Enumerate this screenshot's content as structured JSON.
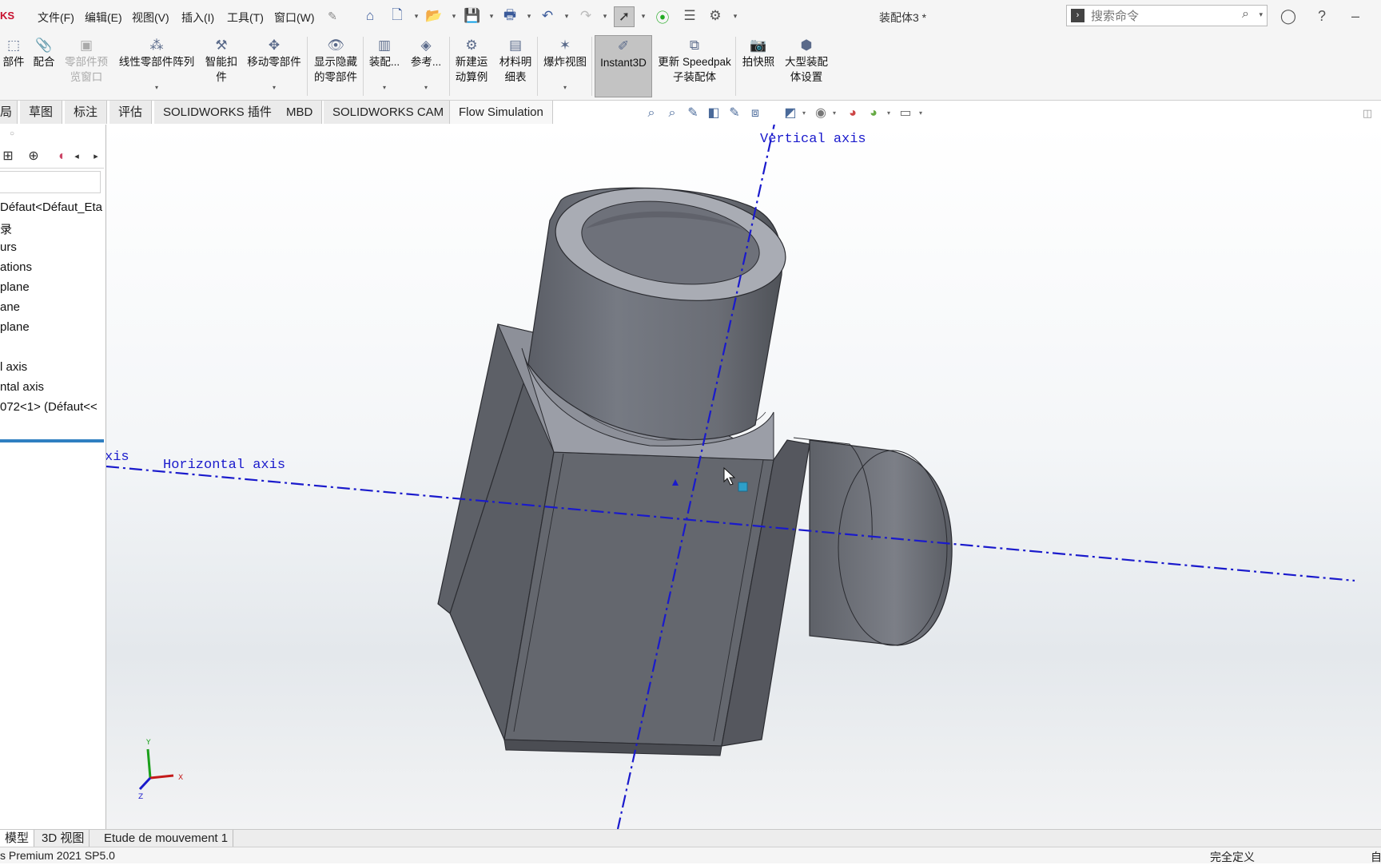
{
  "app": {
    "brand_fragment": "KS",
    "document_title": "装配体3 *"
  },
  "menu": [
    "文件(F)",
    "编辑(E)",
    "视图(V)",
    "插入(I)",
    "工具(T)",
    "窗口(W)"
  ],
  "search": {
    "placeholder": "搜索命令"
  },
  "ribbon": {
    "insert_components": "部件",
    "mate": "配合",
    "component_preview": "零部件预\n览窗口",
    "linear_pattern": "线性零部件阵列",
    "smart_fasteners": "智能扣\n件",
    "move_component": "移动零部件",
    "show_hidden": "显示隐藏\n的零部件",
    "assembly": "装配...",
    "reference": "参考...",
    "new_motion_study": "新建运\n动算例",
    "bom": "材料明\n细表",
    "exploded_view": "爆炸视图",
    "instant3d": "Instant3D",
    "update_speedpak": "更新 Speedpak\n子装配体",
    "snapshot": "拍快照",
    "large_assembly": "大型装配\n体设置"
  },
  "tabs": [
    "局",
    "草图",
    "标注",
    "评估",
    "SOLIDWORKS 插件",
    "MBD",
    "SOLIDWORKS CAM",
    "Flow Simulation"
  ],
  "tree": [
    "Défaut<Défaut_Eta",
    "录",
    "urs",
    "ations",
    "plane",
    "ane",
    "plane",
    "l axis",
    "ntal axis",
    "072<1> (Défaut<<"
  ],
  "viewport": {
    "vertical_axis_label": "Vertical axis",
    "horizontal_axis_label": "Horizontal axis",
    "left_axis_fragment": "xis",
    "triad": {
      "y": "Y",
      "x": "X",
      "z": "Z"
    },
    "colors": {
      "axis": "#1a1acc",
      "part_body": "#6b6e76",
      "part_dark": "#55575e",
      "part_light": "#a2a5ad"
    }
  },
  "bottom_tabs": [
    "模型",
    "3D 视图",
    "Etude de mouvement 1"
  ],
  "status": {
    "left": "s Premium 2021 SP5.0",
    "right": "完全定义",
    "right_edge": "自"
  }
}
